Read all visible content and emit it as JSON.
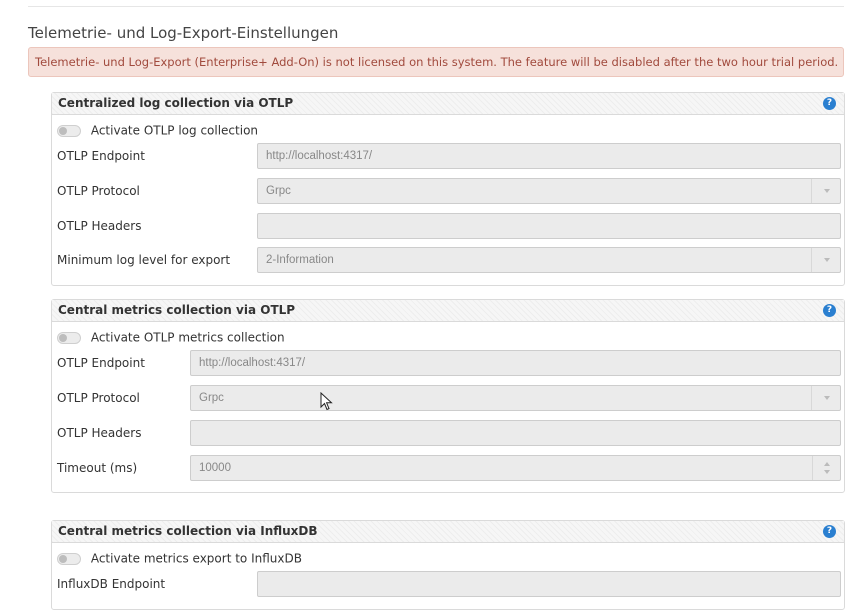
{
  "page": {
    "title": "Telemetrie- und Log-Export-Einstellungen",
    "license_alert": "Telemetrie- und Log-Export (Enterprise+ Add-On) is not licensed on this system. The feature will be disabled after the two hour trial period."
  },
  "panels": [
    {
      "title": "Centralized log collection via OTLP",
      "help_icon": "?",
      "toggle_label": "Activate OTLP log collection",
      "rows": [
        {
          "label": "OTLP Endpoint",
          "value": "http://localhost:4317/"
        },
        {
          "label": "OTLP Protocol",
          "value": "Grpc"
        },
        {
          "label": "OTLP Headers",
          "value": ""
        },
        {
          "label": "Minimum log level for export",
          "value": "2-Information"
        }
      ]
    },
    {
      "title": "Central metrics collection via OTLP",
      "help_icon": "?",
      "toggle_label": "Activate OTLP metrics collection",
      "rows": [
        {
          "label": "OTLP Endpoint",
          "value": "http://localhost:4317/"
        },
        {
          "label": "OTLP Protocol",
          "value": "Grpc"
        },
        {
          "label": "OTLP Headers",
          "value": ""
        },
        {
          "label": "Timeout (ms)",
          "value": "10000"
        }
      ]
    },
    {
      "title": "Central metrics collection via InfluxDB",
      "help_icon": "?",
      "toggle_label": "Activate metrics export to InfluxDB",
      "rows": [
        {
          "label": "InfluxDB Endpoint",
          "value": ""
        }
      ]
    }
  ],
  "colors": {
    "alert_bg": "#f6e1db",
    "alert_text": "#a14a3d",
    "help_icon": "#2a7fd0",
    "field_bg": "#ebebeb"
  },
  "icons": [
    "help-icon",
    "toggle-switch",
    "chevron-down-icon",
    "spinner-arrows-icon",
    "mouse-pointer-icon"
  ]
}
